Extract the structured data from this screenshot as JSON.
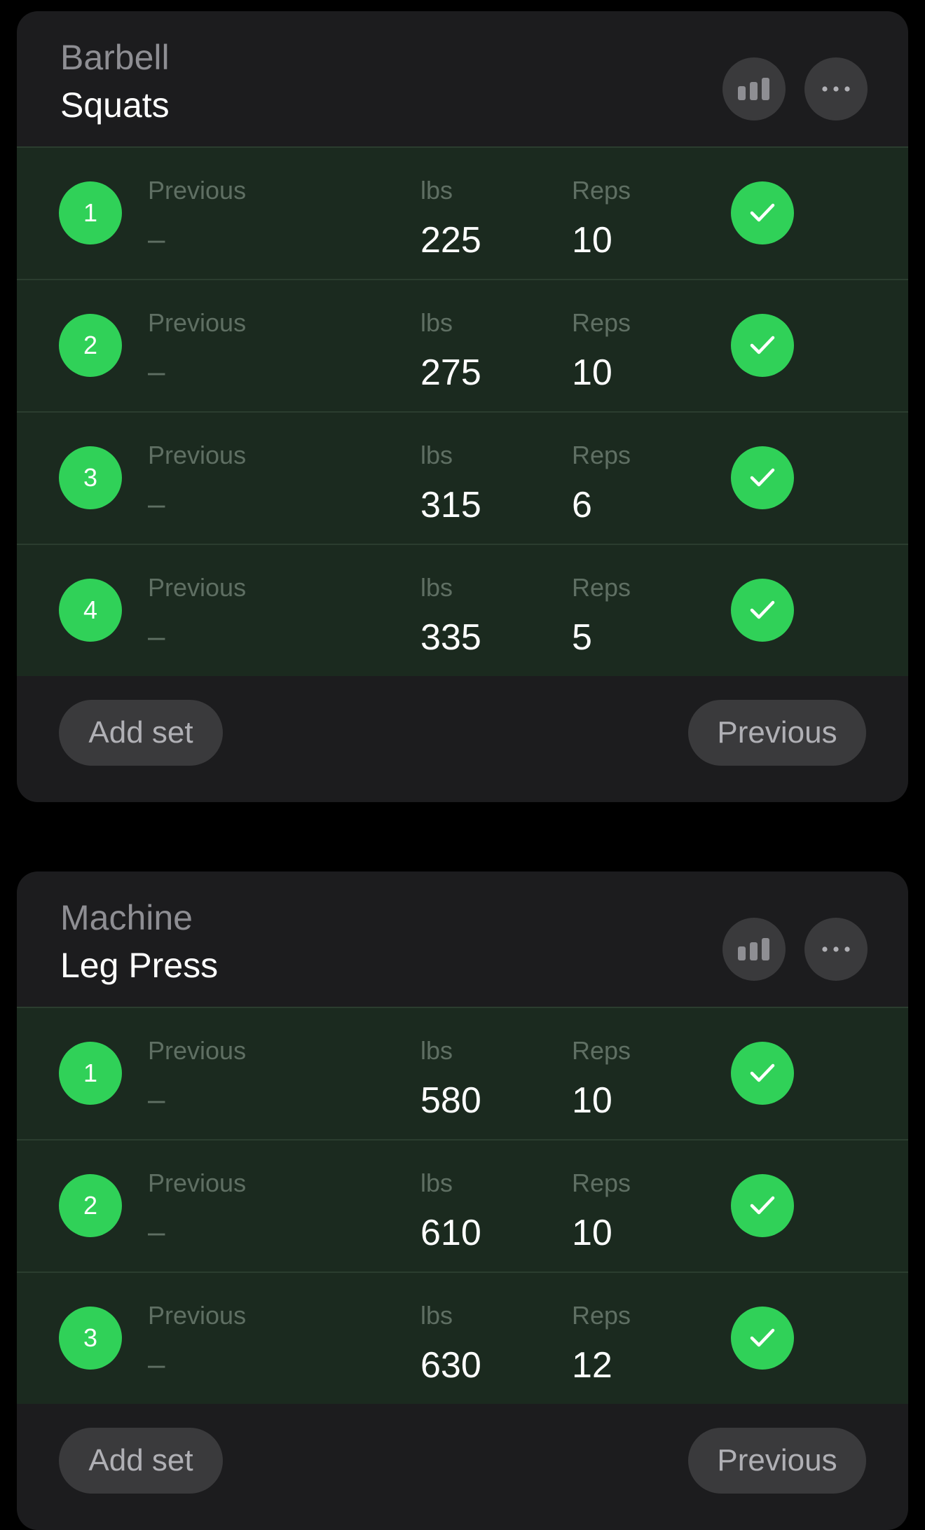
{
  "exercises": [
    {
      "category": "Barbell",
      "name": "Squats",
      "sets": [
        {
          "number": "1",
          "previous_label": "Previous",
          "previous_value": "–",
          "weight_label": "lbs",
          "weight": "225",
          "reps_label": "Reps",
          "reps": "10"
        },
        {
          "number": "2",
          "previous_label": "Previous",
          "previous_value": "–",
          "weight_label": "lbs",
          "weight": "275",
          "reps_label": "Reps",
          "reps": "10"
        },
        {
          "number": "3",
          "previous_label": "Previous",
          "previous_value": "–",
          "weight_label": "lbs",
          "weight": "315",
          "reps_label": "Reps",
          "reps": "6"
        },
        {
          "number": "4",
          "previous_label": "Previous",
          "previous_value": "–",
          "weight_label": "lbs",
          "weight": "335",
          "reps_label": "Reps",
          "reps": "5"
        }
      ],
      "add_set_label": "Add set",
      "previous_button_label": "Previous"
    },
    {
      "category": "Machine",
      "name": "Leg Press",
      "sets": [
        {
          "number": "1",
          "previous_label": "Previous",
          "previous_value": "–",
          "weight_label": "lbs",
          "weight": "580",
          "reps_label": "Reps",
          "reps": "10"
        },
        {
          "number": "2",
          "previous_label": "Previous",
          "previous_value": "–",
          "weight_label": "lbs",
          "weight": "610",
          "reps_label": "Reps",
          "reps": "10"
        },
        {
          "number": "3",
          "previous_label": "Previous",
          "previous_value": "–",
          "weight_label": "lbs",
          "weight": "630",
          "reps_label": "Reps",
          "reps": "12"
        }
      ],
      "add_set_label": "Add set",
      "previous_button_label": "Previous"
    }
  ],
  "icons": {
    "stats": "bar-chart-icon",
    "more": "ellipsis-icon",
    "complete": "checkmark-icon"
  },
  "colors": {
    "accent_green": "#30d158",
    "card_bg": "#1c1c1e",
    "set_bg": "#1b2a1f",
    "button_bg": "#3a3a3c"
  }
}
